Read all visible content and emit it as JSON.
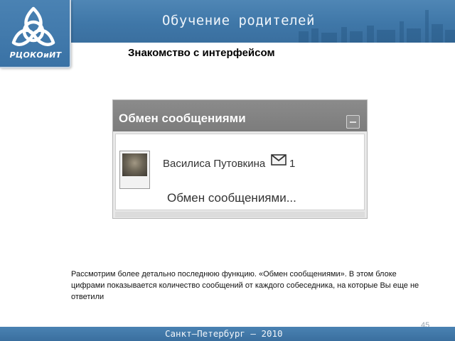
{
  "header": {
    "title": "Обучение родителей",
    "subtitle": "Знакомство с интерфейсом"
  },
  "logo": {
    "text": "РЦОКОиИТ",
    "icon": "trinity-knot-icon"
  },
  "widget": {
    "title": "Обмен сообщениями",
    "collapse_icon": "minus-icon",
    "contact": {
      "name": "Василиса Путовкина",
      "message_icon": "envelope-icon",
      "unread_count": "1"
    },
    "link_label": "Обмен сообщениями..."
  },
  "description": "Рассмотрим более детально последнюю функцию. «Обмен сообщениями». В этом блоке цифрами показывается количество сообщений от каждого собеседника, на которые Вы еще не ответили",
  "page_number": "45",
  "footer": {
    "text": "Санкт–Петербург – 2010"
  },
  "colors": {
    "brand_blue": "#3f77a8",
    "widget_header": "#7f7f7f"
  }
}
